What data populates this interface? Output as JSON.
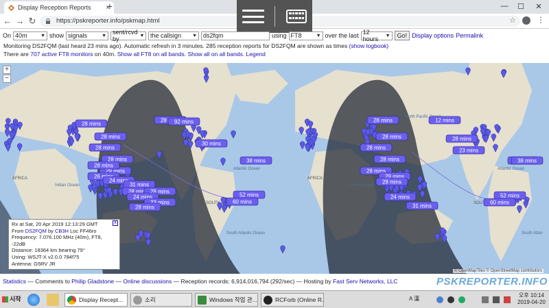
{
  "browser": {
    "tab_title": "Display Reception Reports",
    "tab_close": "×",
    "new_tab": "+",
    "url": "https://pskreporter.info/pskmap.html",
    "star": "☆",
    "menu": "⋮",
    "back": "←",
    "forward": "→",
    "reload": "↻",
    "minimize": "—",
    "maximize": "☐",
    "close": "✕"
  },
  "controls": {
    "on_label": "On",
    "band": "40m",
    "show_label": "show",
    "show_value": "signals",
    "direction": "sent/rcvd by",
    "by_what": "the callsign",
    "callsign": "ds2fqm",
    "using_label": "using",
    "mode": "FT8",
    "over_label": "over the last",
    "period": "12 hours",
    "go_label": "Go!",
    "display_options": "Display options",
    "permalink": "Permalink"
  },
  "status": {
    "monitoring": "Monitoring DS2FQM (last heard 23 mins ago). Automatic refresh in 3 minutes. 285 reception reports for DS2FQM are shown as times",
    "show_logbook": "(show logbook)",
    "line2_pre": "There are",
    "active_count": "707 active FT8 monitors",
    "line2_mid": "on 40m.",
    "show_all_ft8": "Show all FT8 on all bands.",
    "show_all_bands": "Show all on all bands.",
    "legend": "Legend"
  },
  "map": {
    "zoom_in": "+",
    "zoom_out": "−",
    "attribution": "© OpenMapTiles © OpenStreetMap contributors",
    "labels": {
      "africa": "AFRICA",
      "indian_ocean": "Indian Ocean",
      "atlantic_ocean": "Atlantic Ocean",
      "south_atlantic": "South Atlantic Ocean",
      "south_atlantic_short": "South Atlan",
      "north_pacific": "North Pacific Ocean",
      "south_america": "SOUTH AMERICA",
      "south_am_short": "SOUTH AM"
    },
    "bubbles": {
      "b1": "28 mins",
      "b2": "28 mins",
      "b3": "28 mins",
      "b4": "28 mins",
      "b5": "28 mins",
      "b6": "29 mins",
      "b7": "26 mins",
      "b8": "24 mins",
      "b9": "31 mins",
      "b10": "28 mins",
      "b11": "28 mins",
      "b12": "24 mins",
      "b13": "23 mins",
      "b14": "28 mins",
      "b15": "38 mins",
      "b16": "30 mins",
      "b17": "92 mins",
      "b18": "52 mins",
      "b19": "60 mins",
      "b20": "28 mins",
      "b21": "28 mins",
      "b22": "28 mins",
      "b23": "28 mins",
      "b24": "28 mins",
      "b25": "28 mins",
      "b26": "29 mins",
      "b27": "24 mins",
      "b28": "31 mins",
      "b29": "12 mins",
      "b30": "28 mins",
      "b31": "23 mins",
      "b32": "28 mins",
      "b33": "38 mins",
      "b34": "52 mins",
      "b35": "60 mins",
      "b36": "28 mins"
    }
  },
  "popup": {
    "rx": "Rx at Sat, 20 Apr 2019 12:13:29 GMT",
    "from_label": "From",
    "from_call": "DS2FQM",
    "by_label": "by",
    "by_call": "CB3H",
    "loc": "Loc FF46ro",
    "frequency": "Frequency: 7.076.100 MHz (40m), FT8, -22dB",
    "distance": "Distance: 18364 km bearing 79°",
    "using": "Using: WSJT-X v2.0.0 784f75",
    "antenna": "Antenna: G5RV JR",
    "close": "x"
  },
  "footer": {
    "statistics": "Statistics",
    "comments_pre": "— Comments to",
    "philip": "Philip Gladstone",
    "sep1": "—",
    "online": "Online discussions",
    "records": "— Reception records: 6,914,016,794 (292/sec) — Hosting by",
    "fastserv": "Fast Serv Networks, LLC",
    "brand": "PSKREPORTER.INFO"
  },
  "taskbar": {
    "start": "시작",
    "item_chrome": "Display Recept...",
    "item_sound": "소리",
    "item_windows": "Windows 작업 관...",
    "item_rcfors": "RCForb (Online R...",
    "tray_lang": "A 漢",
    "clock_time": "오후 10:14",
    "clock_date": "2019-04-20"
  },
  "colors": {
    "pin": "#5a5ae8",
    "bubble": "#6b5ff0",
    "ocean": "#a9c8e8",
    "land": "#e6e0cf",
    "night": "#1e2430",
    "link": "#1a0dab"
  }
}
